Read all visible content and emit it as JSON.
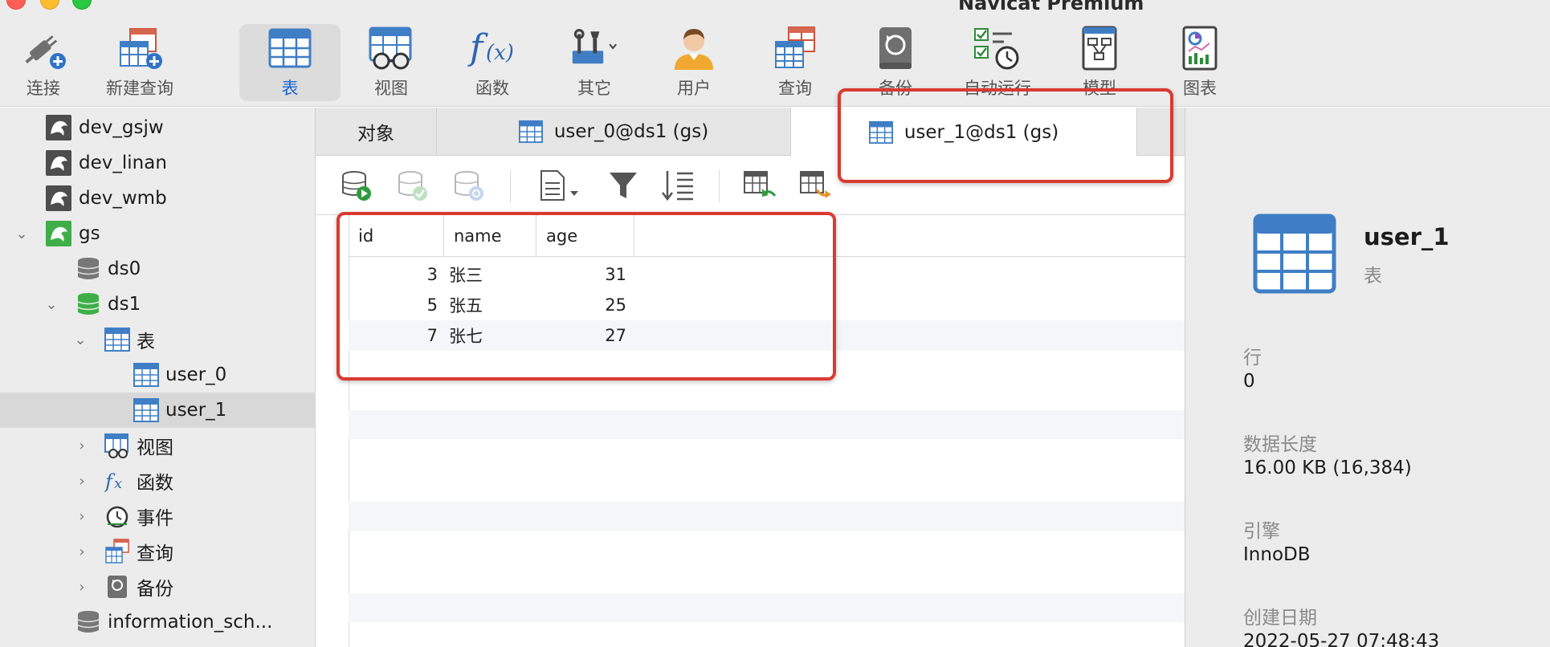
{
  "window": {
    "title": "Navicat Premium"
  },
  "toolbar": {
    "items": [
      {
        "label": "连接",
        "icon": "plug-connect-icon"
      },
      {
        "label": "新建查询",
        "icon": "new-query-icon"
      },
      {
        "label": "表",
        "icon": "table-icon",
        "active": true
      },
      {
        "label": "视图",
        "icon": "view-icon"
      },
      {
        "label": "函数",
        "icon": "function-icon"
      },
      {
        "label": "其它",
        "icon": "tools-icon"
      },
      {
        "label": "用户",
        "icon": "user-icon"
      },
      {
        "label": "查询",
        "icon": "query-icon"
      },
      {
        "label": "备份",
        "icon": "backup-icon"
      },
      {
        "label": "自动运行",
        "icon": "automation-icon"
      },
      {
        "label": "模型",
        "icon": "model-icon"
      },
      {
        "label": "图表",
        "icon": "chart-icon"
      }
    ]
  },
  "sidebar": {
    "items": [
      {
        "label": "dev_gsjw",
        "icon": "mysql-connection-icon"
      },
      {
        "label": "dev_linan",
        "icon": "mysql-connection-icon"
      },
      {
        "label": "dev_wmb",
        "icon": "mysql-connection-icon"
      },
      {
        "label": "gs",
        "icon": "mysql-connection-icon",
        "expanded": true
      },
      {
        "label": "ds0",
        "icon": "database-icon"
      },
      {
        "label": "ds1",
        "icon": "database-icon",
        "expanded": true
      },
      {
        "label": "表",
        "icon": "table-icon",
        "expanded": true
      },
      {
        "label": "user_0",
        "icon": "table-icon"
      },
      {
        "label": "user_1",
        "icon": "table-icon",
        "selected": true
      },
      {
        "label": "视图",
        "icon": "view-icon"
      },
      {
        "label": "函数",
        "icon": "function-icon"
      },
      {
        "label": "事件",
        "icon": "event-clock-icon"
      },
      {
        "label": "查询",
        "icon": "query-icon"
      },
      {
        "label": "备份",
        "icon": "backup-icon"
      },
      {
        "label": "information_sch...",
        "icon": "database-icon"
      }
    ]
  },
  "tabs": [
    {
      "label": "对象"
    },
    {
      "label": "user_0@ds1 (gs)"
    },
    {
      "label": "user_1@ds1 (gs)",
      "active": true
    }
  ],
  "grid": {
    "columns": [
      "id",
      "name",
      "age"
    ],
    "rows": [
      {
        "id": "3",
        "name": "张三",
        "age": "31"
      },
      {
        "id": "5",
        "name": "张五",
        "age": "25"
      },
      {
        "id": "7",
        "name": "张七",
        "age": "27"
      }
    ]
  },
  "info": {
    "table_name": "user_1",
    "table_type": "表",
    "rows_label": "行",
    "rows_value": "0",
    "data_length_label": "数据长度",
    "data_length_value": "16.00 KB (16,384)",
    "engine_label": "引擎",
    "engine_value": "InnoDB",
    "created_label": "创建日期",
    "created_value": "2022-05-27 07:48:43"
  },
  "colors": {
    "highlight": "#d93a30",
    "accent": "#1a62d6",
    "table_icon_blue": "#3f7ec5"
  }
}
